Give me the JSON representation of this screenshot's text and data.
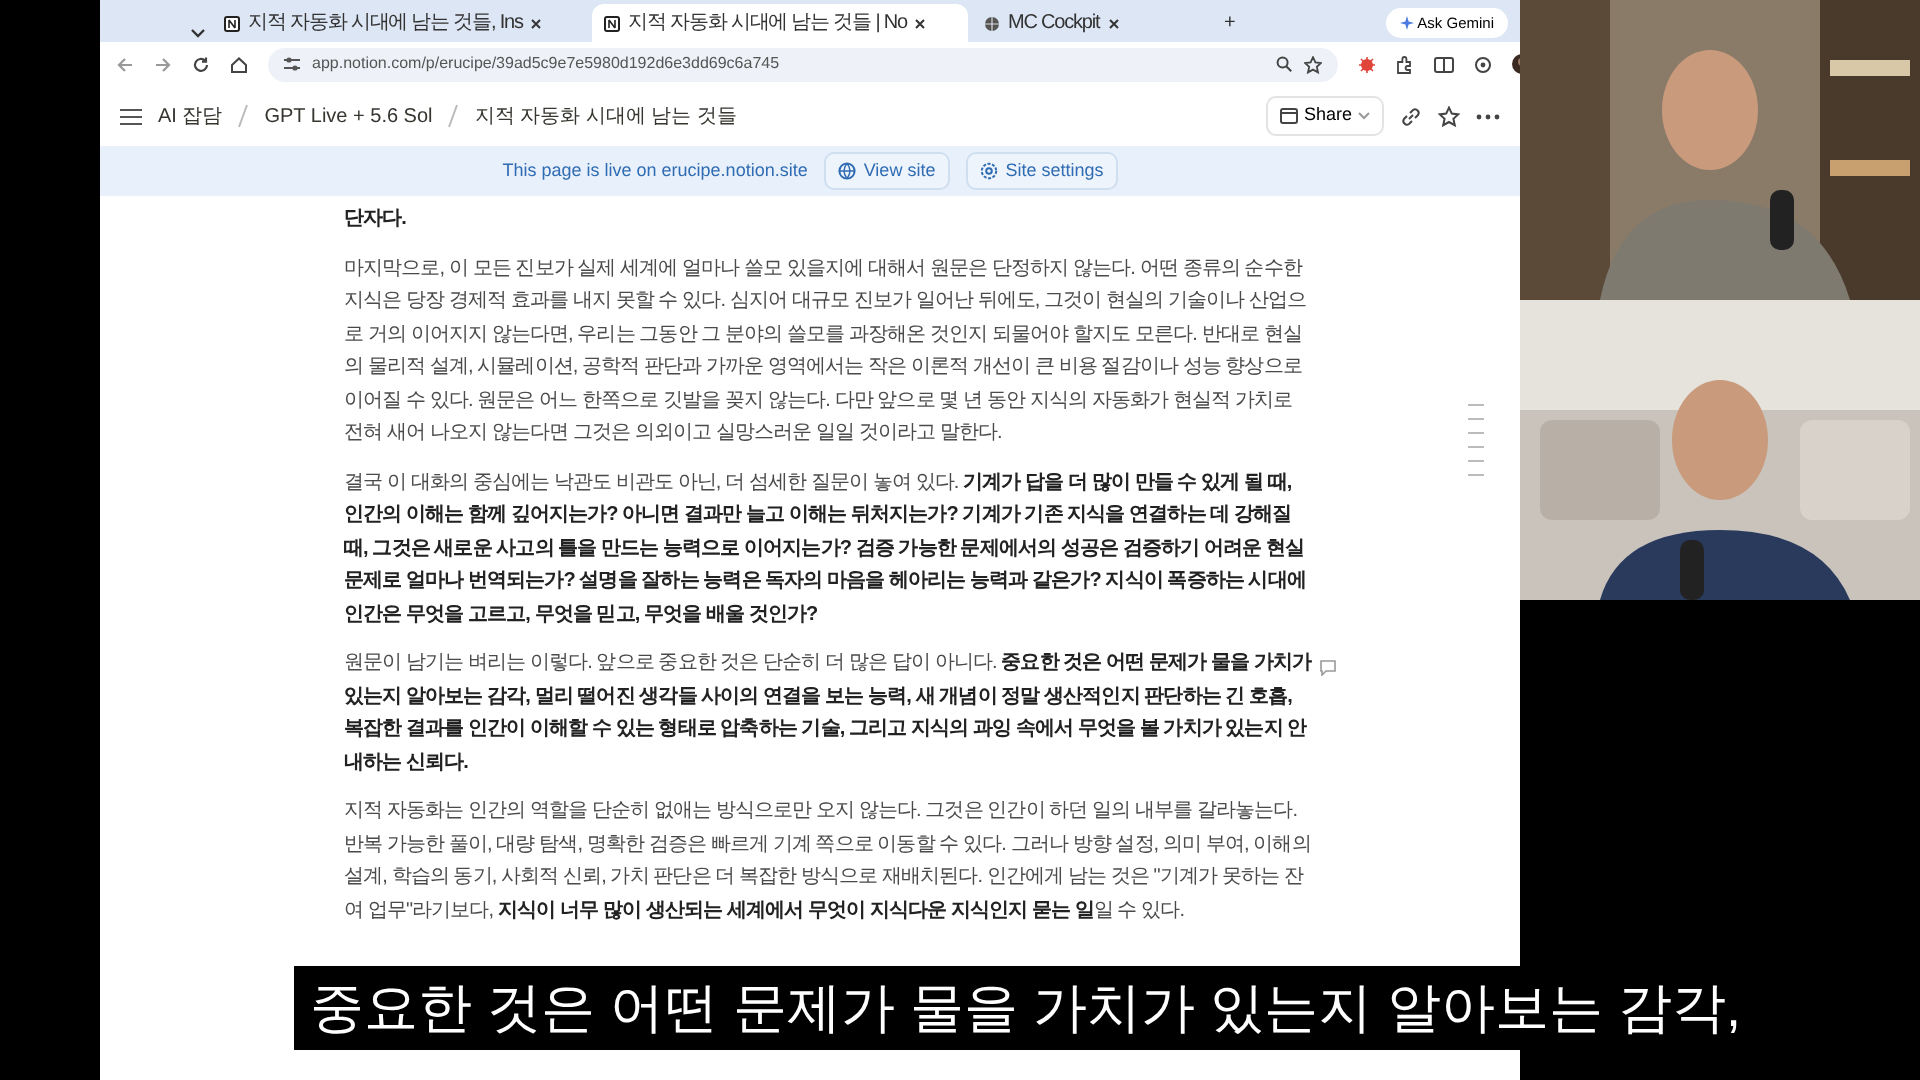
{
  "browser": {
    "tabs": [
      {
        "title": "지적 자동화 시대에 남는 것들, Ins",
        "selected": false
      },
      {
        "title": "지적 자동화 시대에 남는 것들 | No",
        "selected": true
      },
      {
        "title": "MC Cockpit",
        "selected": false
      }
    ],
    "new_tab": "+",
    "gemini": "Ask Gemini",
    "url": "app.notion.com/p/erucipe/39ad5c9e7e5980d192d6e3dd69c6a745"
  },
  "notion": {
    "breadcrumbs": [
      "AI 잡담",
      "GPT Live + 5.6 Sol",
      "지적 자동화 시대에 남는 것들"
    ],
    "share": "Share",
    "banner": {
      "text": "This page is live on erucipe.notion.site",
      "buttons": [
        "View site",
        "Site settings"
      ]
    },
    "paragraphs": [
      {
        "text": "단자다.",
        "bold": true,
        "comment": false
      },
      {
        "text": "마지막으로, 이 모든 진보가 실제 세계에 얼마나 쓸모 있을지에 대해서 원문은 단정하지 않는다. 어떤 종류의 순수한 지식은 당장 경제적 효과를 내지 못할 수 있다. 심지어 대규모 진보가 일어난 뒤에도, 그것이 현실의 기술이나 산업으로 거의 이어지지 않는다면, 우리는 그동안 그 분야의 쓸모를 과장해온 것인지 되물어야 할지도 모른다. 반대로 현실의 물리적 설계, 시뮬레이션, 공학적 판단과 가까운 영역에서는 작은 이론적 개선이 큰 비용 절감이나 성능 향상으로 이어질 수 있다. 원문은 어느 한쪽으로 깃발을 꽂지 않는다. 다만 앞으로 몇 년 동안 지식의 자동화가 현실적 가치로 전혀 새어 나오지 않는다면 그것은 의외이고 실망스러운 일일 것이라고 말한다.",
        "bold": false,
        "comment": false
      },
      {
        "text": "결국 이 대화의 중심에는 낙관도 비관도 아닌, 더 섬세한 질문이 놓여 있다. **기계가 답을 더 많이 만들 수 있게 될 때, 인간의 이해는 함께 깊어지는가? 아니면 결과만 늘고 이해는 뒤처지는가? 기계가 기존 지식을 연결하는 데 강해질 때, 그것은 새로운 사고의 틀을 만드는 능력으로 이어지는가? 검증 가능한 문제에서의 성공은 검증하기 어려운 현실 문제로 얼마나 번역되는가? 설명을 잘하는 능력은 독자의 마음을 헤아리는 능력과 같은가? 지식이 폭증하는 시대에 인간은 무엇을 고르고, 무엇을 믿고, 무엇을 배울 것인가?**",
        "bold": false,
        "comment": false
      },
      {
        "text": "원문이 남기는 벼리는 이렇다. 앞으로 중요한 것은 단순히 더 많은 답이 아니다. **중요한 것은 어떤 문제가 물을 가치가 있는지 알아보는 감각, 멀리 떨어진 생각들 사이의 연결을 보는 능력, 새 개념이 정말 생산적인지 판단하는 긴 호흡, 복잡한 결과를 인간이 이해할 수 있는 형태로 압축하는 기술, 그리고 지식의 과잉 속에서 무엇을 볼 가치가 있는지 안내하는 신뢰다.**",
        "bold": false,
        "comment": true
      },
      {
        "text": "지적 자동화는 인간의 역할을 단순히 없애는 방식으로만 오지 않는다. 그것은 인간이 하던 일의 내부를 갈라놓는다. 반복 가능한 풀이, 대량 탐색, 명확한 검증은 빠르게 기계 쪽으로 이동할 수 있다. 그러나 방향 설정, 의미 부여, 이해의 설계, 학습의 동기, 사회적 신뢰, 가치 판단은 더 복잡한 방식으로 재배치된다. 인간에게 남는 것은 \"기계가 못하는 잔여 업무\"라기보다, **지식이 너무 많이 생산되는 세계에서 무엇이 지식다운 지식인지 묻는 일**일 수 있다.",
        "bold": false,
        "comment": false
      }
    ]
  },
  "subtitle": "중요한 것은 어떤 문제가 물을 가치가 있는지 알아보는 감각,"
}
